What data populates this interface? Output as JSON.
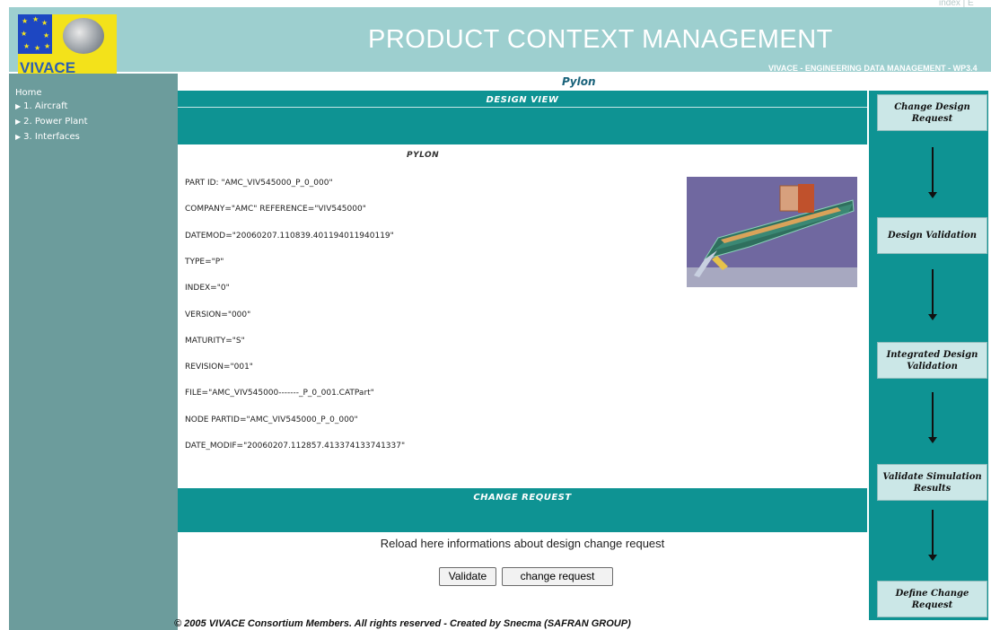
{
  "header": {
    "title": "PRODUCT CONTEXT MANAGEMENT",
    "subtitle": "VIVACE - ENGINEERING DATA MANAGEMENT - WP3.4",
    "top_links": "index | E",
    "logo_text": "VIVACE"
  },
  "sidebar": {
    "home": "Home",
    "items": [
      {
        "label": "1. Aircraft"
      },
      {
        "label": "2. Power Plant"
      },
      {
        "label": "3. Interfaces"
      }
    ]
  },
  "main": {
    "heading": "Pylon",
    "design_view_label": "DESIGN VIEW",
    "part_title": "PYLON",
    "attributes": [
      "PART ID: \"AMC_VIV545000_P_0_000\"",
      "COMPANY=\"AMC\" REFERENCE=\"VIV545000\"",
      "DATEMOD=\"20060207.110839.401194011940119\"",
      "TYPE=\"P\"",
      "INDEX=\"0\"",
      "VERSION=\"000\"",
      "MATURITY=\"S\"",
      "REVISION=\"001\"",
      "FILE=\"AMC_VIV545000-------_P_0_001.CATPart\"",
      "NODE PARTID=\"AMC_VIV545000_P_0_000\"",
      "DATE_MODIF=\"20060207.112857.413374133741337\""
    ],
    "change_request_label": "CHANGE REQUEST",
    "reload_text": "Reload here informations about design change request",
    "validate_button": "Validate",
    "change_request_button": "change request"
  },
  "workflow": {
    "steps": [
      {
        "line1": "Change Design",
        "line2": "Request"
      },
      {
        "line1": "Design Validation",
        "line2": ""
      },
      {
        "line1": "Integrated Design",
        "line2": "Validation"
      },
      {
        "line1": "Validate Simulation",
        "line2": "Results"
      },
      {
        "line1": "Define Change",
        "line2": "Request"
      }
    ]
  },
  "footer": {
    "text": "© 2005 VIVACE Consortium Members. All rights reserved - Created by Snecma (SAFRAN GROUP)"
  }
}
